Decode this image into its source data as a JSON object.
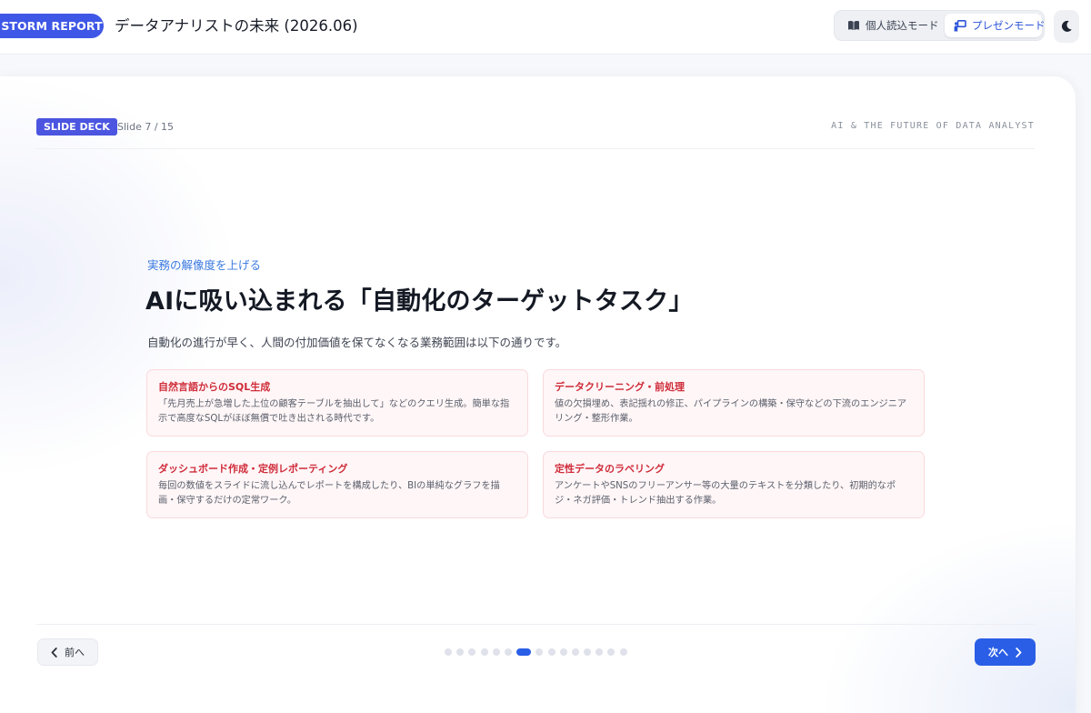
{
  "header": {
    "brand": "STORM REPORT",
    "title": "データアナリストの未来 (2026.06)",
    "modes": {
      "reader_label": "個人読込モード",
      "present_label": "プレゼンモード",
      "active": "present"
    },
    "theme_icon": "moon-icon"
  },
  "slide_header": {
    "deck_label": "SLIDE DECK",
    "slide_count": "Slide 7 / 15",
    "subject": "AI & THE FUTURE OF DATA ANALYST"
  },
  "slide": {
    "eyebrow": "実務の解像度を上げる",
    "title": "AIに吸い込まれる「自動化のターゲットタスク」",
    "lead": "自動化の進行が早く、人間の付加価値を保てなくなる業務範囲は以下の通りです。",
    "cards": [
      {
        "title": "自然言語からのSQL生成",
        "body": "「先月売上が急増した上位の顧客テーブルを抽出して」などのクエリ生成。簡単な指示で高度なSQLがほぼ無償で吐き出される時代です。"
      },
      {
        "title": "データクリーニング・前処理",
        "body": "値の欠損埋め、表記揺れの修正、パイプラインの構築・保守などの下流のエンジニアリング・整形作業。"
      },
      {
        "title": "ダッシュボード作成・定例レポーティング",
        "body": "毎回の数値をスライドに流し込んでレポートを構成したり、BIの単純なグラフを描画・保守するだけの定常ワーク。"
      },
      {
        "title": "定性データのラベリング",
        "body": "アンケートやSNSのフリーアンサー等の大量のテキストを分類したり、初期的なポジ・ネガ評価・トレンド抽出する作業。"
      }
    ]
  },
  "footer": {
    "prev_label": "前へ",
    "next_label": "次へ",
    "total_slides": 15,
    "current_slide": 7
  },
  "colors": {
    "accent": "#2a5ee6",
    "brand": "#3f57e6",
    "card_title": "#cf2c3a",
    "card_bg": "#fff6f7"
  }
}
